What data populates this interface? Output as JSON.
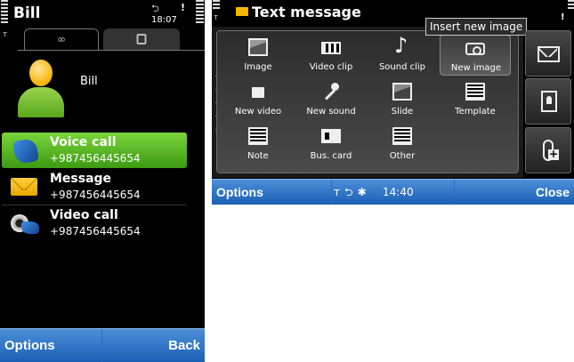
{
  "left": {
    "title": "Bill",
    "time": "18:07",
    "indicator": "!",
    "tabs": [
      {
        "icon": "call-details-icon"
      },
      {
        "icon": "contact-card-icon"
      }
    ],
    "contact_name": "Bill",
    "actions": [
      {
        "label": "Voice call",
        "number": "+987456445654",
        "icon": "phone-icon",
        "selected": true
      },
      {
        "label": "Message",
        "number": "+987456445654",
        "icon": "envelope-icon",
        "selected": false
      },
      {
        "label": "Video call",
        "number": "+987456445654",
        "icon": "video-call-icon",
        "selected": false
      }
    ],
    "softkeys": {
      "left": "Options",
      "right": "Back"
    },
    "colors": {
      "selection": "#58b82a",
      "softbar": "#2a6ec4"
    }
  },
  "right": {
    "title": "Text message",
    "indicator": "!",
    "tooltip": "Insert new image",
    "insert_items": [
      {
        "label": "Image",
        "icon": "image-icon"
      },
      {
        "label": "Video clip",
        "icon": "film-icon"
      },
      {
        "label": "Sound clip",
        "icon": "music-note-icon"
      },
      {
        "label": "New image",
        "icon": "camera-icon",
        "active": true
      },
      {
        "label": "New video",
        "icon": "video-camera-icon"
      },
      {
        "label": "New sound",
        "icon": "microphone-icon"
      },
      {
        "label": "Slide",
        "icon": "slide-icon"
      },
      {
        "label": "Template",
        "icon": "template-icon"
      },
      {
        "label": "Note",
        "icon": "note-icon"
      },
      {
        "label": "Bus. card",
        "icon": "business-card-icon"
      },
      {
        "label": "Other",
        "icon": "document-icon"
      }
    ],
    "side_buttons": [
      {
        "icon": "send-envelope-icon"
      },
      {
        "icon": "contacts-book-icon"
      },
      {
        "icon": "attach-add-icon"
      }
    ],
    "status": {
      "time": "14:40"
    },
    "softkeys": {
      "left": "Options",
      "right": "Close"
    }
  }
}
